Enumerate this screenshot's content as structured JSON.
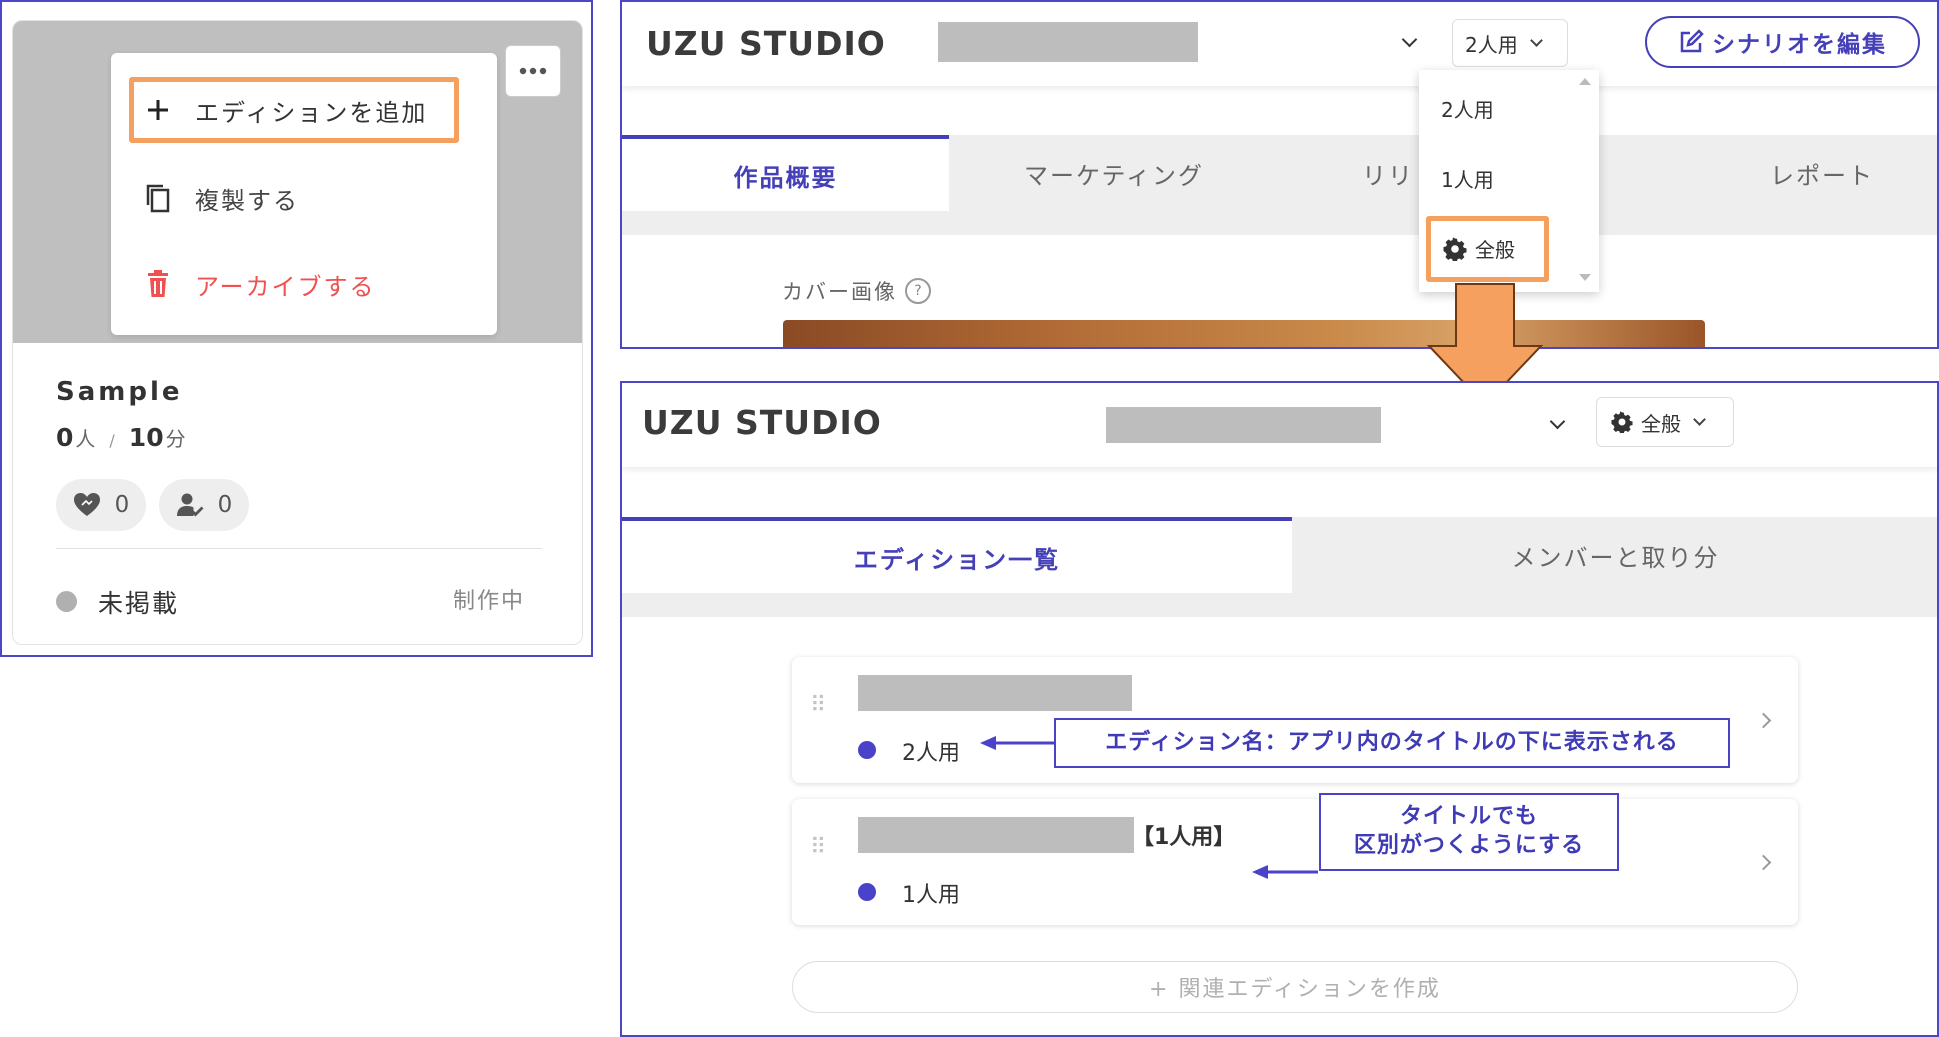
{
  "colors": {
    "frame": "#4b47c8",
    "highlight": "#f5a05e",
    "accent": "#4540b8",
    "danger": "#f05050",
    "arrow": "#f5a05e"
  },
  "card": {
    "more_icon": "more-horizontal-icon",
    "menu": {
      "add_edition": "エディションを追加",
      "duplicate": "複製する",
      "archive": "アーカイブする"
    },
    "title": "Sample",
    "players_value": "0",
    "players_unit": "人",
    "separator": "/",
    "time_value": "10",
    "time_unit": "分",
    "likes": "0",
    "plays": "0",
    "status": "未掲載",
    "progress": "制作中"
  },
  "studio_top": {
    "logo": "UZU STUDIO",
    "edition_select": "2人用",
    "edit_button": "シナリオを編集",
    "tabs": [
      "作品概要",
      "マーケティング",
      "リリ",
      "レポート"
    ],
    "dropdown": [
      "2人用",
      "1人用",
      "全般"
    ],
    "cover_label": "カバー画像",
    "help_icon": "?"
  },
  "studio_bottom": {
    "logo": "UZU STUDIO",
    "edition_select": "全般",
    "tabs": [
      "エディション一覧",
      "メンバーと取り分"
    ],
    "editions": [
      {
        "name": "2人用",
        "callout": "エディション名：アプリ内のタイトルの下に表示される"
      },
      {
        "title_suffix": "【1人用】",
        "name": "1人用",
        "callout_line1": "タイトルでも",
        "callout_line2": "区別がつくようにする"
      }
    ],
    "create_button": "+ 関連エディションを作成"
  }
}
